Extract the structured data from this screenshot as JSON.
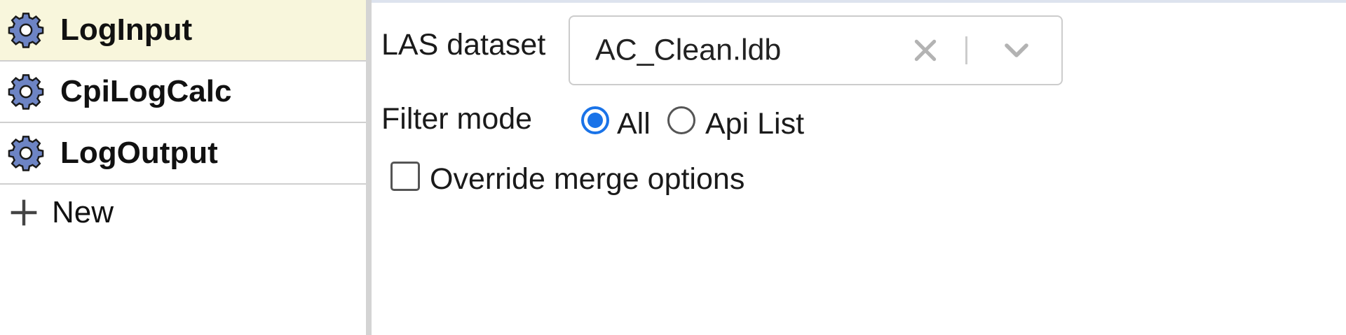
{
  "sidebar": {
    "items": [
      {
        "label": "LogInput",
        "icon": "gear-icon",
        "selected": true
      },
      {
        "label": "CpiLogCalc",
        "icon": "gear-icon",
        "selected": false
      },
      {
        "label": "LogOutput",
        "icon": "gear-icon",
        "selected": false
      }
    ],
    "new_item": {
      "label": "New",
      "icon": "plus-icon"
    }
  },
  "form": {
    "las_dataset": {
      "label": "LAS dataset",
      "value": "AC_Clean.ldb"
    },
    "filter_mode": {
      "label": "Filter mode",
      "options": [
        {
          "label": "All",
          "checked": true
        },
        {
          "label": "Api List",
          "checked": false
        }
      ]
    },
    "override_merge": {
      "label": "Override merge options",
      "checked": false
    }
  },
  "colors": {
    "selected_row_bg": "#f8f6dc",
    "accent": "#1a73e8",
    "gear_fill": "#6d84c4"
  }
}
